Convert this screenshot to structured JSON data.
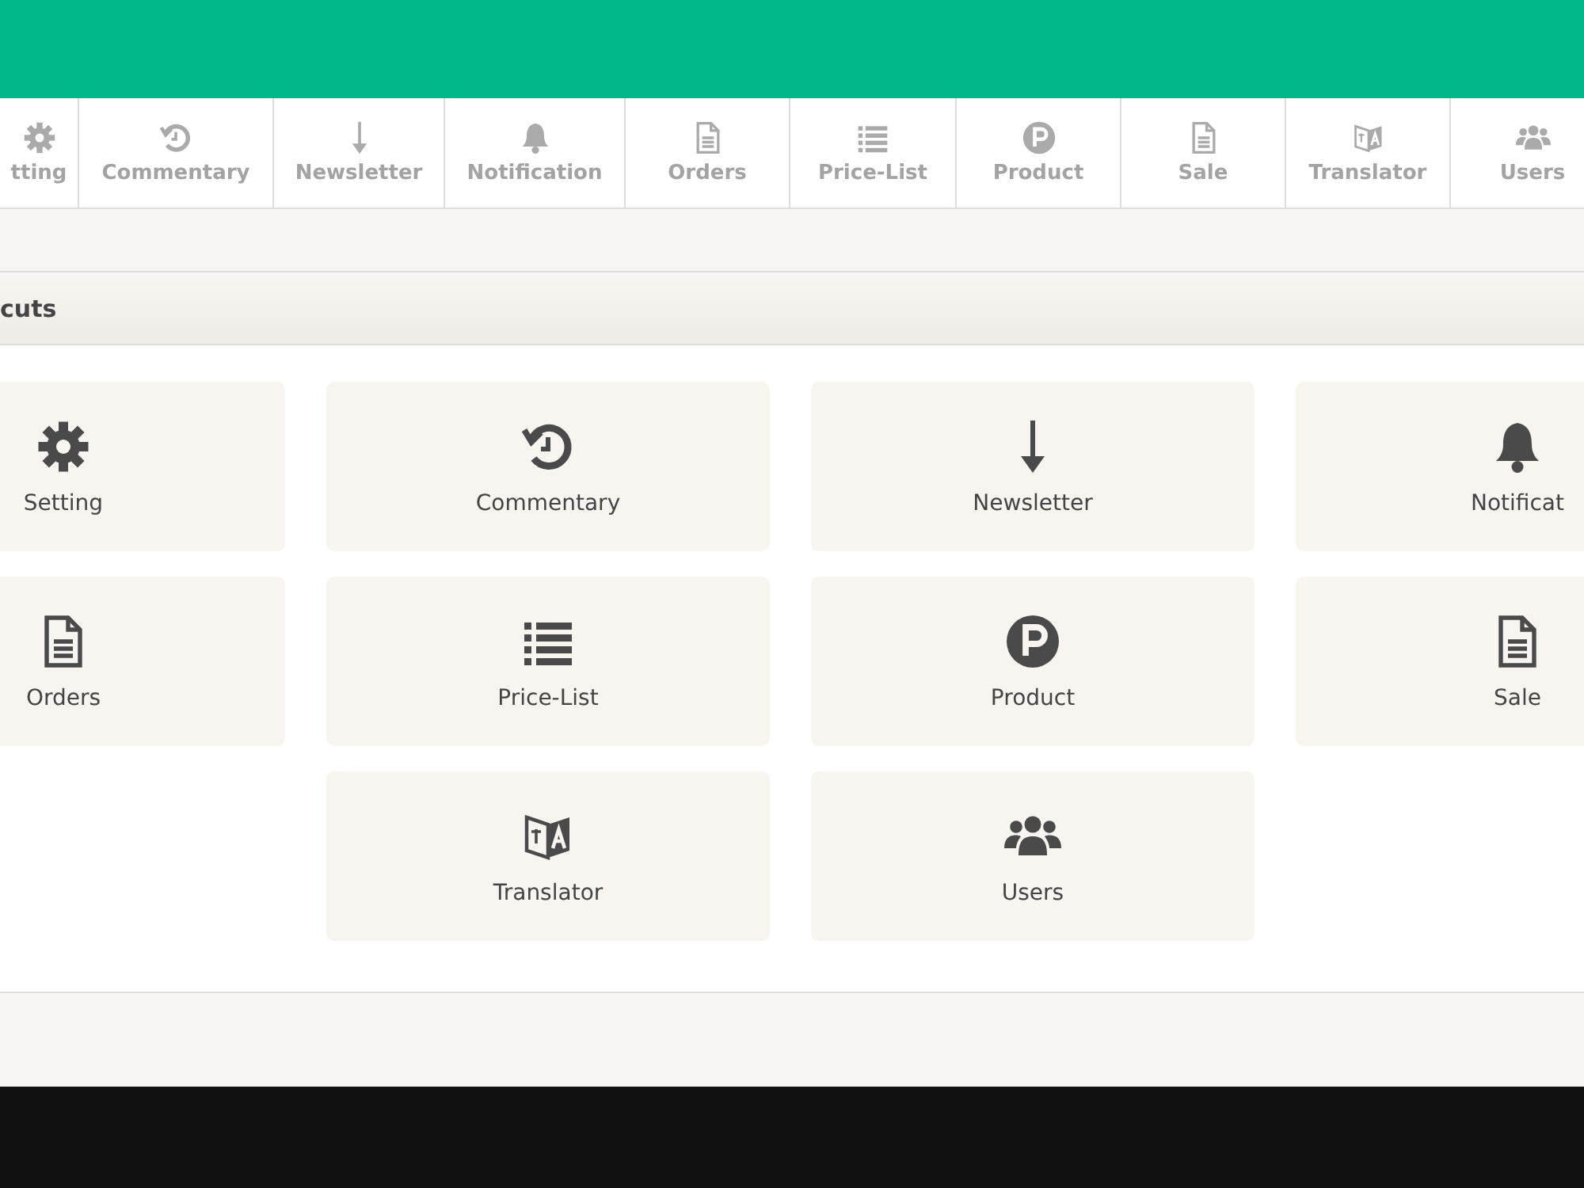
{
  "tabs": [
    {
      "label": "tting",
      "kind": "gear"
    },
    {
      "label": "Commentary",
      "kind": "history"
    },
    {
      "label": "Newsletter",
      "kind": "arrow"
    },
    {
      "label": "Notification",
      "kind": "bell"
    },
    {
      "label": "Orders",
      "kind": "document"
    },
    {
      "label": "Price-List",
      "kind": "list"
    },
    {
      "label": "Product",
      "kind": "p-circle"
    },
    {
      "label": "Sale",
      "kind": "document"
    },
    {
      "label": "Translator",
      "kind": "translate"
    },
    {
      "label": "Users",
      "kind": "users"
    }
  ],
  "panel": {
    "title": "cuts",
    "tiles": [
      {
        "label": "Setting",
        "kind": "gear"
      },
      {
        "label": "Commentary",
        "kind": "history"
      },
      {
        "label": "Newsletter",
        "kind": "arrow"
      },
      {
        "label": "Notificat",
        "kind": "bell"
      },
      {
        "label": "Orders",
        "kind": "document"
      },
      {
        "label": "Price-List",
        "kind": "list"
      },
      {
        "label": "Product",
        "kind": "p-circle"
      },
      {
        "label": "Sale",
        "kind": "document"
      },
      {
        "label": "Translator",
        "kind": "translate"
      },
      {
        "label": "Users",
        "kind": "users"
      }
    ]
  }
}
